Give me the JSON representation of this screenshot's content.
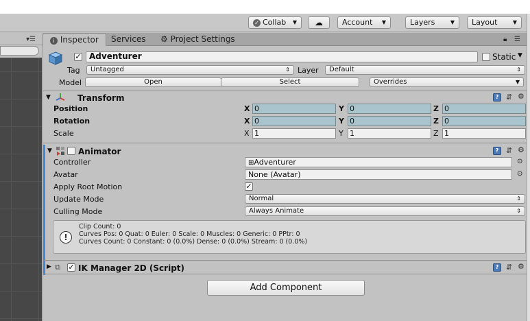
{
  "toolbar": {
    "collab": "Collab",
    "account": "Account",
    "layers": "Layers",
    "layout": "Layout"
  },
  "tabs": {
    "inspector": "Inspector",
    "services": "Services",
    "project_settings": "Project Settings"
  },
  "gameobject": {
    "name": "Adventurer",
    "static_label": "Static",
    "tag_label": "Tag",
    "tag_value": "Untagged",
    "layer_label": "Layer",
    "layer_value": "Default",
    "model_label": "Model",
    "open": "Open",
    "select": "Select",
    "overrides": "Overrides"
  },
  "transform": {
    "title": "Transform",
    "position_label": "Position",
    "rotation_label": "Rotation",
    "scale_label": "Scale",
    "axis_x": "X",
    "axis_y": "Y",
    "axis_z": "Z",
    "position": {
      "x": "0",
      "y": "0",
      "z": "0"
    },
    "rotation": {
      "x": "0",
      "y": "0",
      "z": "0"
    },
    "scale": {
      "x": "1",
      "y": "1",
      "z": "1"
    }
  },
  "animator": {
    "title": "Animator",
    "controller_label": "Controller",
    "controller_value": "Adventurer",
    "avatar_label": "Avatar",
    "avatar_value": "None (Avatar)",
    "apply_root_motion_label": "Apply Root Motion",
    "update_mode_label": "Update Mode",
    "update_mode_value": "Normal",
    "culling_mode_label": "Culling Mode",
    "culling_mode_value": "Always Animate",
    "info_line1": "Clip Count: 0",
    "info_line2": "Curves Pos: 0 Quat: 0 Euler: 0 Scale: 0 Muscles: 0 Generic: 0 PPtr: 0",
    "info_line3": "Curves Count: 0 Constant: 0 (0.0%) Dense: 0 (0.0%) Stream: 0 (0.0%)"
  },
  "ik_manager": {
    "title": "IK Manager 2D (Script)"
  },
  "add_component": "Add Component",
  "colors": {
    "accent_blue": "#3f8ad8",
    "scene_bg": "#474747",
    "inspector_bg": "#c2c2c2",
    "vector_field_bg": "#a9c4cc"
  }
}
